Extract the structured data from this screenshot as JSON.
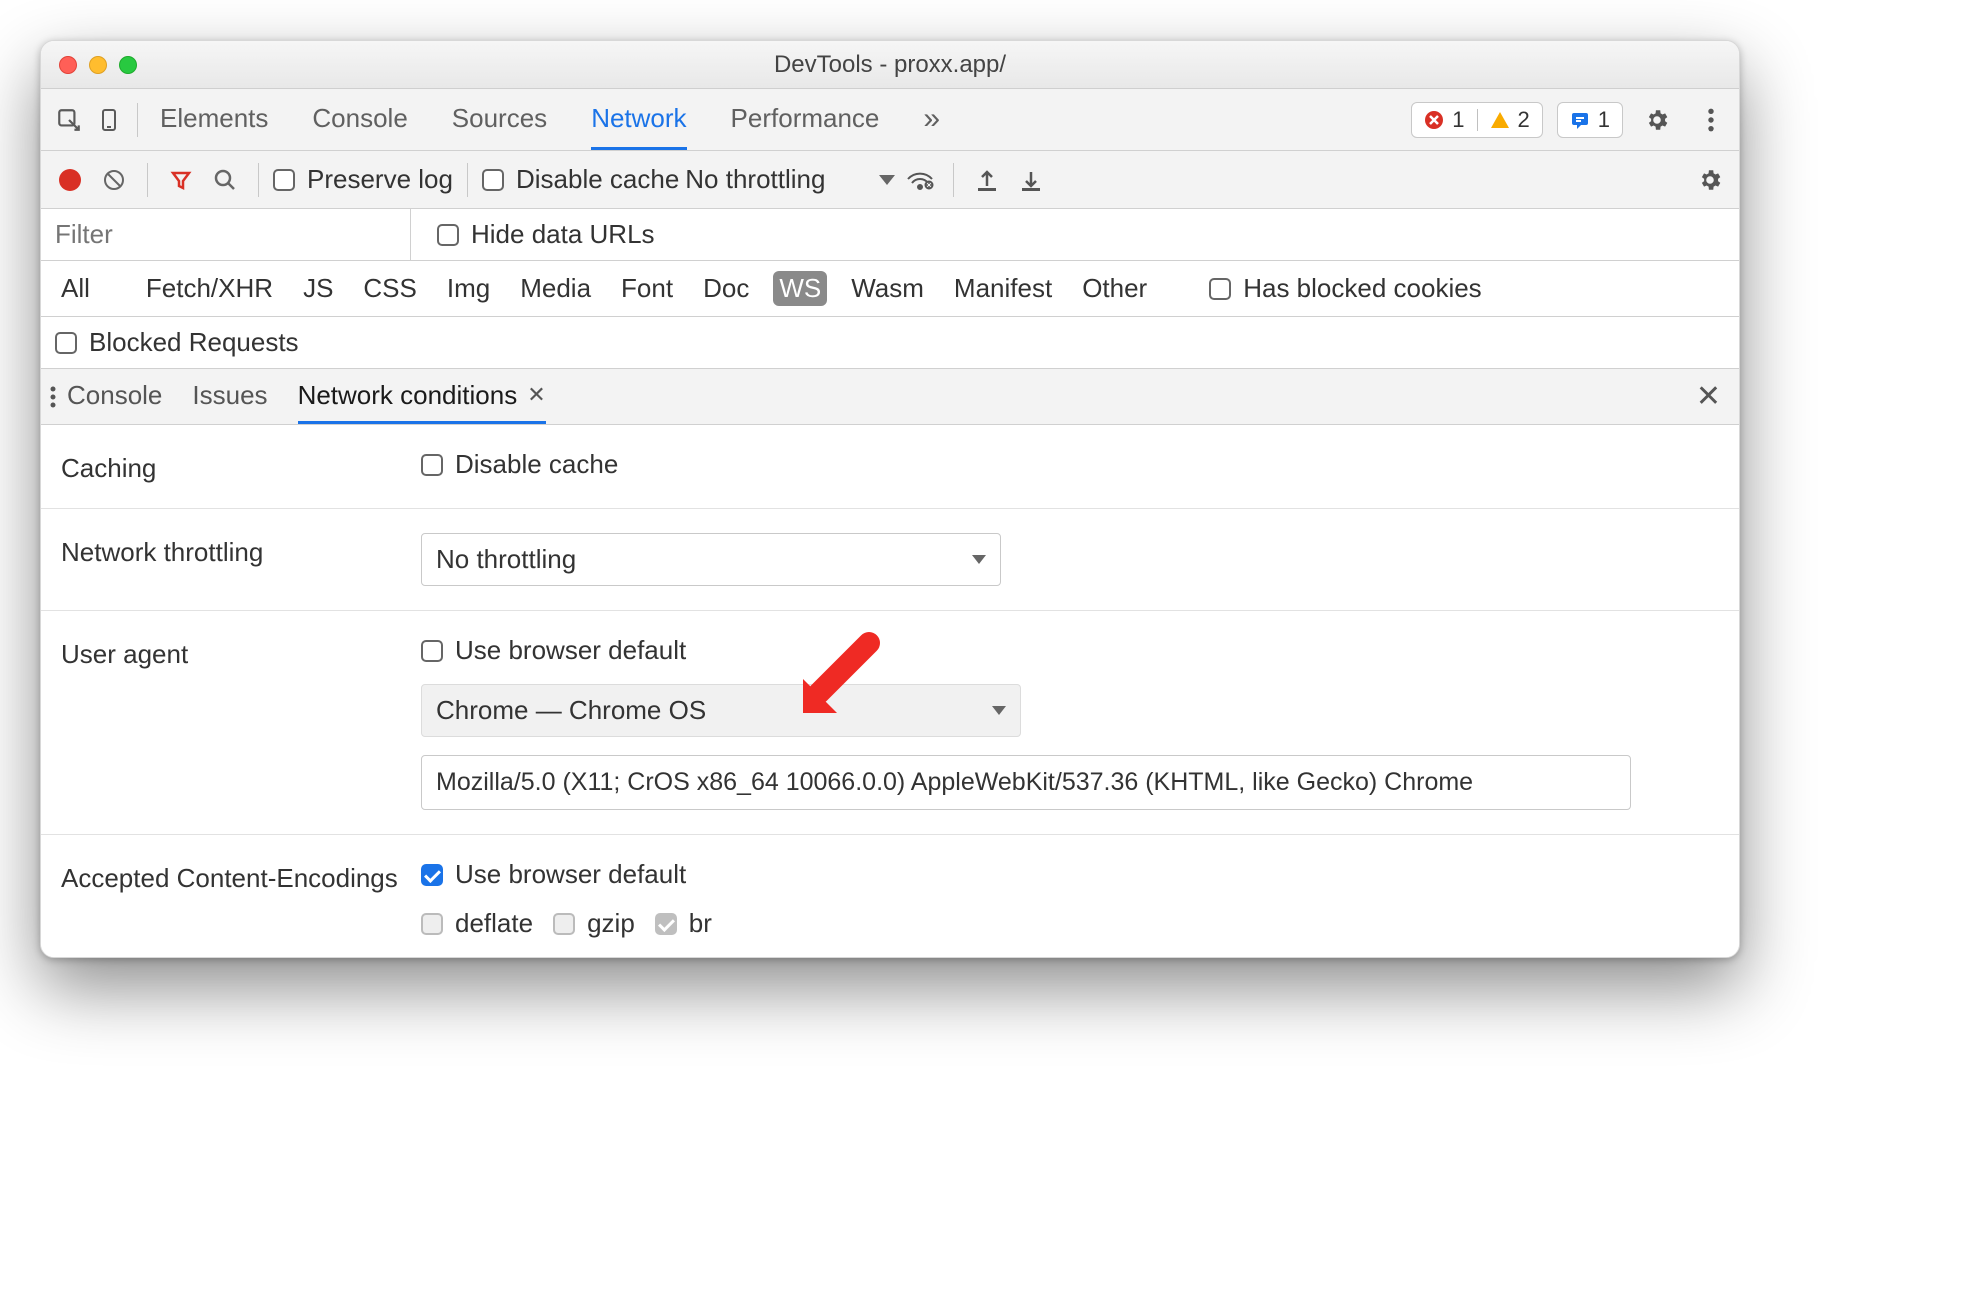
{
  "window": {
    "title": "DevTools - proxx.app/"
  },
  "tabs": {
    "items": [
      "Elements",
      "Console",
      "Sources",
      "Network",
      "Performance"
    ],
    "active": "Network",
    "overflow": "»",
    "counters": {
      "errors": "1",
      "warnings": "2",
      "messages": "1"
    }
  },
  "toolbar": {
    "preserve_log": "Preserve log",
    "disable_cache": "Disable cache",
    "throttling": {
      "label": "No throttling"
    }
  },
  "filter": {
    "placeholder": "Filter",
    "hide_data_urls": "Hide data URLs",
    "types": [
      "All",
      "Fetch/XHR",
      "JS",
      "CSS",
      "Img",
      "Media",
      "Font",
      "Doc",
      "WS",
      "Wasm",
      "Manifest",
      "Other"
    ],
    "selected_type": "WS",
    "has_blocked_cookies": "Has blocked cookies",
    "blocked_requests": "Blocked Requests"
  },
  "drawer": {
    "tabs": {
      "console": "Console",
      "issues": "Issues",
      "netcond": "Network conditions"
    },
    "active": "Network conditions"
  },
  "netcond": {
    "caching": {
      "label": "Caching",
      "disable_cache": "Disable cache"
    },
    "throttling": {
      "label": "Network throttling",
      "select": "No throttling"
    },
    "useragent": {
      "label": "User agent",
      "use_default": "Use browser default",
      "select": "Chrome — Chrome OS",
      "text": "Mozilla/5.0 (X11; CrOS x86_64 10066.0.0) AppleWebKit/537.36 (KHTML, like Gecko) Chrome"
    },
    "encodings": {
      "label": "Accepted Content-Encodings",
      "use_default": "Use browser default",
      "opt_deflate": "deflate",
      "opt_gzip": "gzip",
      "opt_br": "br"
    }
  }
}
